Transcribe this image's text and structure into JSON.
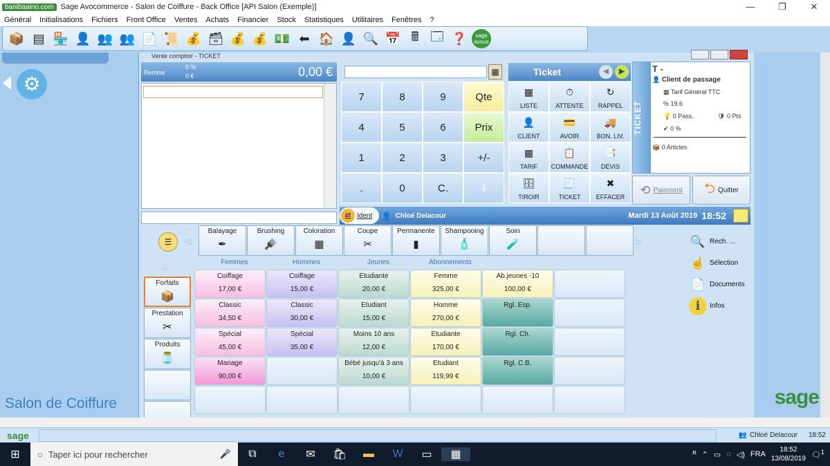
{
  "window": {
    "logo_text": "banibaaino.com",
    "title": "Sage Avocommerce - Salon de Coiffure - Back Office [API Salon (Exemple)]"
  },
  "menu": [
    "Général",
    "Initialisations",
    "Fichiers",
    "Front Office",
    "Ventes",
    "Achats",
    "Financier",
    "Stock",
    "Statistiques",
    "Utilitaires",
    "Fenêtres",
    "?"
  ],
  "toolbar": {
    "icons": [
      "box-icon",
      "layers-icon",
      "shop-icon",
      "user-icon",
      "users-icon",
      "users-alt-icon",
      "document-icon",
      "document-stamp-icon",
      "coins-document-icon",
      "register-icon",
      "coins-icon",
      "coins-stack-icon",
      "bills-icon",
      "arrow-left-icon",
      "home-coins-icon",
      "user-coins-icon",
      "magnifier-icon",
      "calendar-icon",
      "calculator-icon",
      "windows-icon",
      "help-icon",
      "sage-icon"
    ],
    "sage_label": "sage avous"
  },
  "left_panel": {
    "brand": "Salon de Coiffure"
  },
  "pos": {
    "window_title": "Vente comptoir - TICKET",
    "remise_label": "Remise",
    "remise_pct": "0 %",
    "remise_eur": "0 €",
    "total": "0,00 €",
    "keypad": [
      "7",
      "8",
      "9",
      "Qte",
      "4",
      "5",
      "6",
      "Prix",
      "1",
      "2",
      "3",
      "+/-",
      ".",
      "0",
      "C.",
      ""
    ],
    "ticket_header": "Ticket",
    "actions": [
      {
        "label": "LISTE",
        "icon": "list-icon"
      },
      {
        "label": "ATTENTE",
        "icon": "clock-icon"
      },
      {
        "label": "RAPPEL",
        "icon": "recall-icon"
      },
      {
        "label": "CLIENT",
        "icon": "client-icon"
      },
      {
        "label": "AVOIR",
        "icon": "credit-icon"
      },
      {
        "label": "BON. LIV.",
        "icon": "delivery-icon"
      },
      {
        "label": "TARIF",
        "icon": "price-icon"
      },
      {
        "label": "COMMANDE",
        "icon": "order-icon"
      },
      {
        "label": "DEVIS",
        "icon": "quote-icon"
      },
      {
        "label": "TIROIR",
        "icon": "drawer-icon"
      },
      {
        "label": "TICKET",
        "icon": "receipt-icon"
      },
      {
        "label": "EFFACER",
        "icon": "erase-icon"
      }
    ],
    "client": {
      "tab": "TICKET",
      "code": "T -",
      "name": "Client de passage",
      "tarif": "Tarif Général TTC",
      "tva": "19,6",
      "passages": "0 Pass.",
      "points": "0 Pts",
      "remise": "0 %",
      "articles": "0 Articles"
    },
    "pay_label": "Paiement",
    "quit_label": "Quitter",
    "ident_label": "Ident",
    "user": "Chloé Delacour",
    "date": "Mardi 13 Août 2019",
    "time": "18:52"
  },
  "categories": [
    {
      "label": "Balayage",
      "icon": "brush-pen-icon"
    },
    {
      "label": "Brushing",
      "icon": "hairbrush-icon"
    },
    {
      "label": "Coloration",
      "icon": "palette-icon"
    },
    {
      "label": "Coupe",
      "icon": "scissors-icon"
    },
    {
      "label": "Permanente",
      "icon": "perm-icon"
    },
    {
      "label": "Shampooing",
      "icon": "shampoo-icon"
    },
    {
      "label": "Soin",
      "icon": "care-tube-icon"
    },
    {
      "label": "",
      "icon": ""
    },
    {
      "label": "",
      "icon": ""
    }
  ],
  "column_heads": [
    "Femmes",
    "Hommes",
    "Jeunes",
    "Abonnements"
  ],
  "side_tabs": [
    {
      "label": "Forfaits",
      "icon": "package-icon"
    },
    {
      "label": "Prestation",
      "icon": "scissors-icon"
    },
    {
      "label": "Produits",
      "icon": "jar-icon"
    }
  ],
  "grid": [
    [
      {
        "n": "Coiffage",
        "p": "17,00 €",
        "c": "pink"
      },
      {
        "n": "Coiffage",
        "p": "15,00 €",
        "c": "lav"
      },
      {
        "n": "Etudiante",
        "p": "20,00 €",
        "c": "mint"
      },
      {
        "n": "Femme",
        "p": "325,00 €",
        "c": "yel"
      },
      {
        "n": "Ab.jeunes -10",
        "p": "100,00 €",
        "c": "yel"
      },
      {
        "n": "",
        "p": "",
        "c": ""
      }
    ],
    [
      {
        "n": "Classic",
        "p": "34,50 €",
        "c": "pink"
      },
      {
        "n": "Classic",
        "p": "30,00 €",
        "c": "lav"
      },
      {
        "n": "Etudiant",
        "p": "15,00 €",
        "c": "mint"
      },
      {
        "n": "Homme",
        "p": "270,00 €",
        "c": "yel"
      },
      {
        "n": "Rgl. Esp.",
        "p": "",
        "c": "teal"
      },
      {
        "n": "",
        "p": "",
        "c": ""
      }
    ],
    [
      {
        "n": "Spécial",
        "p": "45,00 €",
        "c": "pink"
      },
      {
        "n": "Spécial",
        "p": "35,00 €",
        "c": "lav"
      },
      {
        "n": "Moins 10 ans",
        "p": "12,00 €",
        "c": "mint"
      },
      {
        "n": "Etudiante",
        "p": "170,00 €",
        "c": "yel"
      },
      {
        "n": "Rgl. Ch.",
        "p": "",
        "c": "teal"
      },
      {
        "n": "",
        "p": "",
        "c": ""
      }
    ],
    [
      {
        "n": "Mariage",
        "p": "90,00 €",
        "c": "pinkd"
      },
      {
        "n": "",
        "p": "",
        "c": ""
      },
      {
        "n": "Bébé jusqu'à 3 ans",
        "p": "10,00 €",
        "c": "mint"
      },
      {
        "n": "Etudiant",
        "p": "119,99 €",
        "c": "yel"
      },
      {
        "n": "Rgl. C.B.",
        "p": "",
        "c": "teal"
      },
      {
        "n": "",
        "p": "",
        "c": ""
      }
    ],
    [
      {
        "n": "",
        "p": "",
        "c": ""
      },
      {
        "n": "",
        "p": "",
        "c": ""
      },
      {
        "n": "",
        "p": "",
        "c": ""
      },
      {
        "n": "",
        "p": "",
        "c": ""
      },
      {
        "n": "",
        "p": "",
        "c": ""
      },
      {
        "n": "",
        "p": "",
        "c": ""
      }
    ]
  ],
  "right_links": [
    {
      "label": "Rech. ...",
      "icon": "search-icon"
    },
    {
      "label": "Sélection",
      "icon": "selection-icon"
    },
    {
      "label": "Documents",
      "icon": "documents-icon"
    },
    {
      "label": "Infos",
      "icon": "info-icon"
    }
  ],
  "right_brand": "sage",
  "appstatus": {
    "logo": "sage",
    "user": "Chloé Delacour",
    "time": "18:52"
  },
  "taskbar": {
    "search_placeholder": "Taper ici pour rechercher",
    "lang": "FRA",
    "time": "18:52",
    "date": "13/08/2019",
    "notif_count": "1"
  }
}
